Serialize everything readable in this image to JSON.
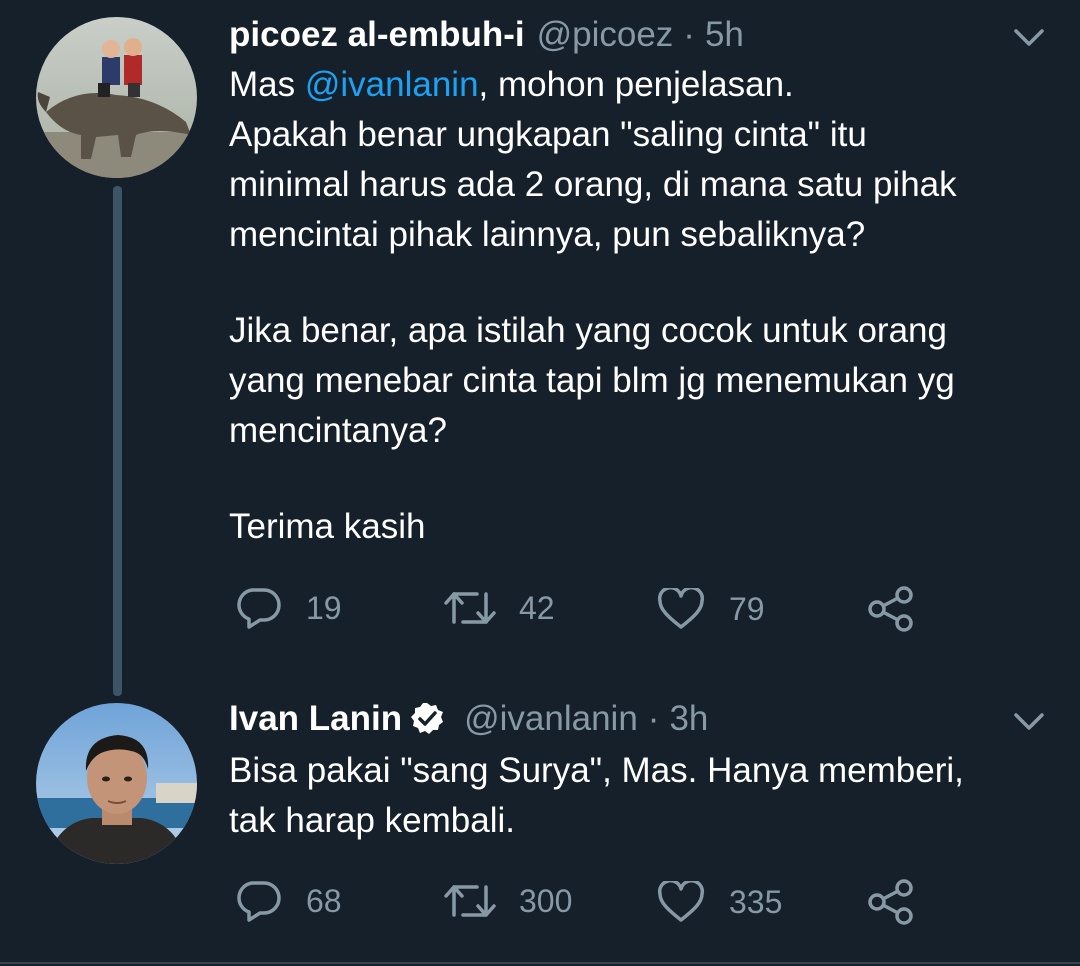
{
  "tweets": [
    {
      "display_name": "picoez al-embuh-i",
      "handle": "@picoez",
      "separator": "·",
      "time": "5h",
      "avatar_icon": "avatar-photo-dinosaur-riders",
      "verified": false,
      "lines": [
        {
          "pre": "Mas ",
          "mention": "@ivanlanin",
          "post": ", mohon penjelasan."
        },
        {
          "text": "Apakah benar ungkapan \"saling cinta\" itu"
        },
        {
          "text": "minimal harus ada 2 orang, di mana satu pihak"
        },
        {
          "text": "mencintai pihak lainnya, pun sebaliknya?"
        },
        {
          "text": ""
        },
        {
          "text": "Jika benar, apa istilah yang cocok untuk orang"
        },
        {
          "text": "yang menebar cinta tapi blm jg menemukan yg"
        },
        {
          "text": "mencintanya?"
        },
        {
          "text": ""
        },
        {
          "text": "Terima kasih"
        }
      ],
      "actions": {
        "replies": "19",
        "retweets": "42",
        "likes": "79"
      }
    },
    {
      "display_name": "Ivan Lanin",
      "handle": "@ivanlanin",
      "separator": "·",
      "time": "3h",
      "avatar_icon": "avatar-photo-man-seaside",
      "verified": true,
      "lines": [
        {
          "text": "Bisa pakai \"sang Surya\", Mas. Hanya memberi,"
        },
        {
          "text": "tak harap kembali."
        }
      ],
      "actions": {
        "replies": "68",
        "retweets": "300",
        "likes": "335"
      }
    }
  ],
  "colors": {
    "background": "#15202b",
    "text": "#ffffff",
    "muted": "#8899a6",
    "mention": "#1da1f2",
    "thread_line": "#3d5466"
  },
  "icons": [
    "reply-icon",
    "retweet-icon",
    "like-icon",
    "share-icon",
    "chevron-down-icon",
    "verified-badge-icon"
  ]
}
